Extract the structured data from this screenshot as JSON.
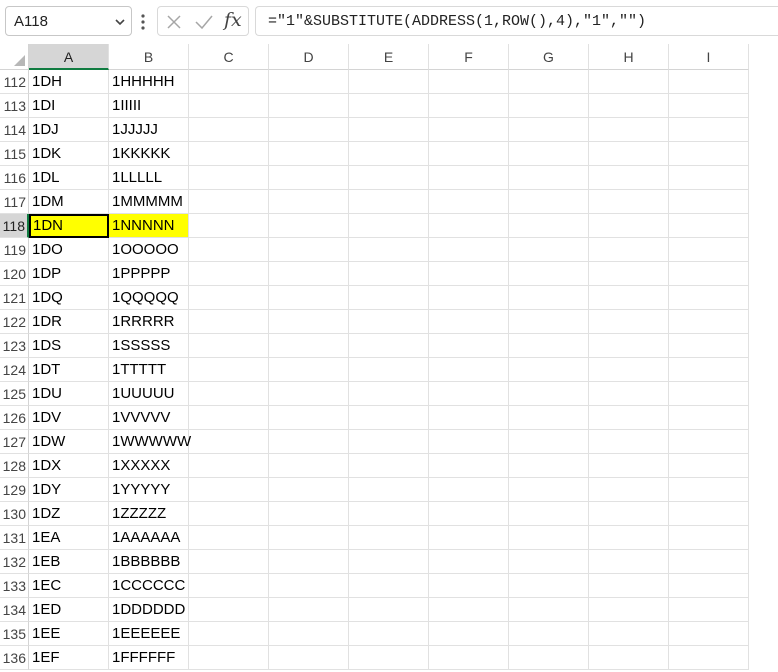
{
  "name_box": {
    "value": "A118"
  },
  "formula_bar": {
    "cancel_icon": "close-icon",
    "enter_icon": "check-icon",
    "insert_function_label": "fx",
    "formula": "=\"1\"&SUBSTITUTE(ADDRESS(1,ROW(),4),\"1\",\"\")"
  },
  "columns": [
    "A",
    "B",
    "C",
    "D",
    "E",
    "F",
    "G",
    "H",
    "I"
  ],
  "selected_column": "A",
  "selected_row": "118",
  "highlight_color": "#ffff00",
  "rows": [
    {
      "num": "112",
      "a": "1DH",
      "b": "1HHHHH"
    },
    {
      "num": "113",
      "a": "1DI",
      "b": "1IIIII"
    },
    {
      "num": "114",
      "a": "1DJ",
      "b": "1JJJJJ"
    },
    {
      "num": "115",
      "a": "1DK",
      "b": "1KKKKK"
    },
    {
      "num": "116",
      "a": "1DL",
      "b": "1LLLLL"
    },
    {
      "num": "117",
      "a": "1DM",
      "b": "1MMMMM"
    },
    {
      "num": "118",
      "a": "1DN",
      "b": "1NNNNN"
    },
    {
      "num": "119",
      "a": "1DO",
      "b": "1OOOOO"
    },
    {
      "num": "120",
      "a": "1DP",
      "b": "1PPPPP"
    },
    {
      "num": "121",
      "a": "1DQ",
      "b": "1QQQQQ"
    },
    {
      "num": "122",
      "a": "1DR",
      "b": "1RRRRR"
    },
    {
      "num": "123",
      "a": "1DS",
      "b": "1SSSSS"
    },
    {
      "num": "124",
      "a": "1DT",
      "b": "1TTTTT"
    },
    {
      "num": "125",
      "a": "1DU",
      "b": "1UUUUU"
    },
    {
      "num": "126",
      "a": "1DV",
      "b": "1VVVVV"
    },
    {
      "num": "127",
      "a": "1DW",
      "b": "1WWWWW"
    },
    {
      "num": "128",
      "a": "1DX",
      "b": "1XXXXX"
    },
    {
      "num": "129",
      "a": "1DY",
      "b": "1YYYYY"
    },
    {
      "num": "130",
      "a": "1DZ",
      "b": "1ZZZZZ"
    },
    {
      "num": "131",
      "a": "1EA",
      "b": "1AAAAAA"
    },
    {
      "num": "132",
      "a": "1EB",
      "b": "1BBBBBB"
    },
    {
      "num": "133",
      "a": "1EC",
      "b": "1CCCCCC"
    },
    {
      "num": "134",
      "a": "1ED",
      "b": "1DDDDDD"
    },
    {
      "num": "135",
      "a": "1EE",
      "b": "1EEEEEE"
    },
    {
      "num": "136",
      "a": "1EF",
      "b": "1FFFFFF"
    }
  ]
}
